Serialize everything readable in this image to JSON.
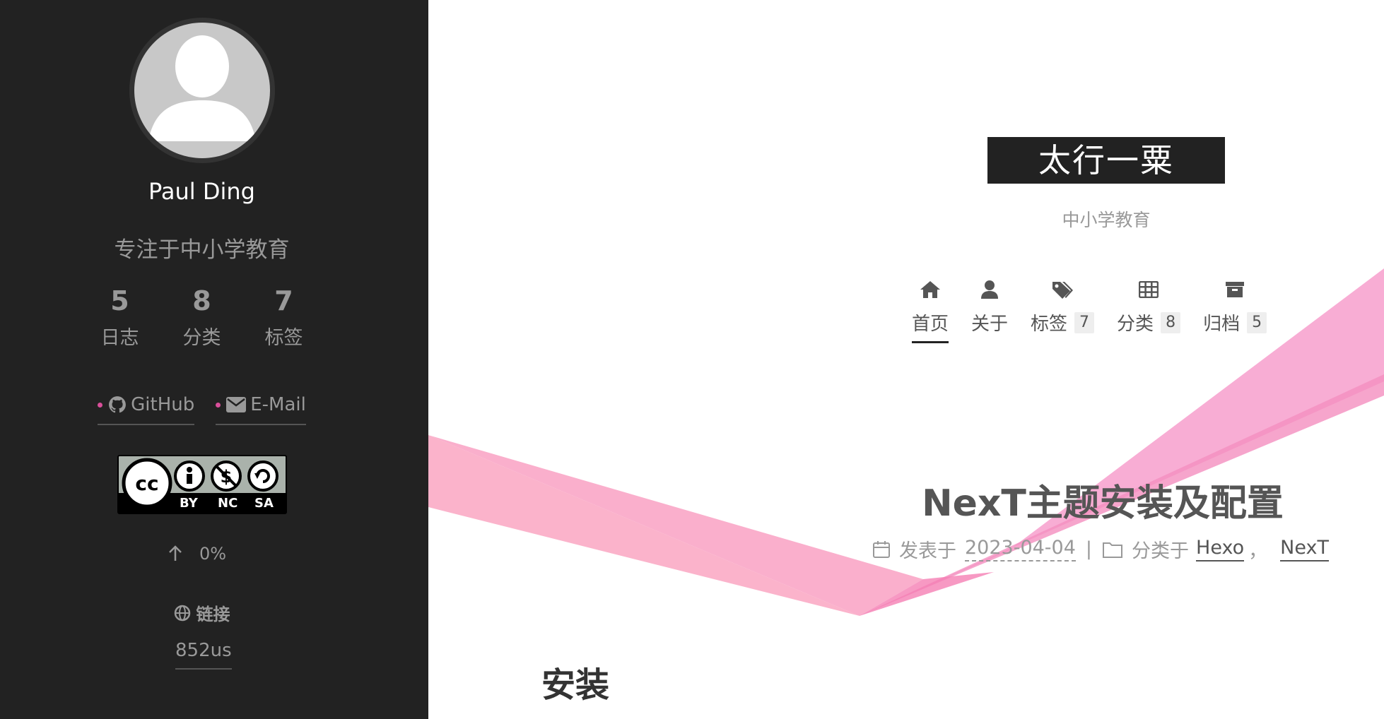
{
  "sidebar": {
    "author_name": "Paul Ding",
    "author_description": "专注于中小学教育",
    "state": [
      {
        "count": "5",
        "label": "日志"
      },
      {
        "count": "8",
        "label": "分类"
      },
      {
        "count": "7",
        "label": "标签"
      }
    ],
    "social": [
      {
        "label": "GitHub",
        "icon": "github-icon"
      },
      {
        "label": "E-Mail",
        "icon": "envelope-icon"
      }
    ],
    "license": {
      "by": "BY",
      "nc": "NC",
      "sa": "SA"
    },
    "back_to_top": "0%",
    "blogroll_title": "链接",
    "blogroll_links": [
      "852us"
    ]
  },
  "header": {
    "site_title": "太行一粟",
    "site_subtitle": "中小学教育"
  },
  "menu": [
    {
      "label": "首页",
      "icon": "home-icon",
      "badge": ""
    },
    {
      "label": "关于",
      "icon": "user-icon",
      "badge": ""
    },
    {
      "label": "标签",
      "icon": "tags-icon",
      "badge": "7"
    },
    {
      "label": "分类",
      "icon": "th-icon",
      "badge": "8"
    },
    {
      "label": "归档",
      "icon": "archive-icon",
      "badge": "5"
    }
  ],
  "post": {
    "title": "NexT主题安装及配置",
    "posted_label": "发表于",
    "date": "2023-04-04",
    "separator": "|",
    "category_label": "分类于",
    "categories": [
      "Hexo",
      "NexT"
    ],
    "category_separator": "，",
    "section_heading": "安装"
  },
  "colors": {
    "sidebar_bg": "#222222",
    "ribbon": "#f7a1c4",
    "text_muted": "#999999"
  }
}
